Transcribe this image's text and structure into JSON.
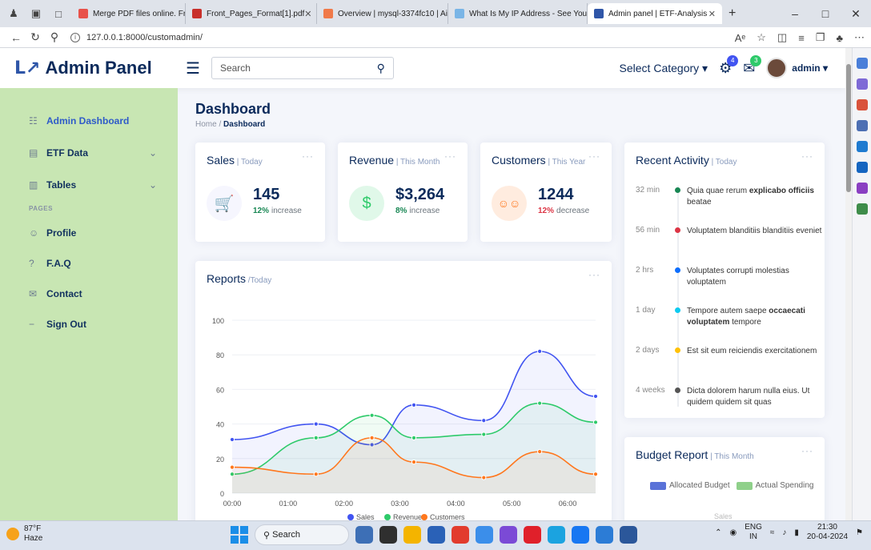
{
  "browser": {
    "tabs": [
      {
        "label": "Merge PDF files online. Free serv",
        "color": "#e8524a"
      },
      {
        "label": "Front_Pages_Format[1].pdf",
        "color": "#c8302b"
      },
      {
        "label": "Overview | mysql-3374fc10 | Aiv",
        "color": "#f07a4a"
      },
      {
        "label": "What Is My IP Address - See You",
        "color": "#7ab5e6"
      },
      {
        "label": "Admin panel | ETF-Analysis",
        "color": "#2f56a8"
      }
    ],
    "url": "127.0.0.1:8000/customadmin/"
  },
  "header": {
    "logo_mark": "L↗",
    "logo_text": "Admin Panel",
    "search_placeholder": "Search",
    "select_category": "Select Category ▾",
    "notif_count": "4",
    "msg_count": "3",
    "username": "admin ▾"
  },
  "sidebar": {
    "items": [
      {
        "label": "Admin Dashboard",
        "icon": "☷"
      },
      {
        "label": "ETF Data",
        "icon": "▤"
      },
      {
        "label": "Tables",
        "icon": "▥"
      },
      {
        "label": "Profile",
        "icon": "☺"
      },
      {
        "label": "F.A.Q",
        "icon": "?"
      },
      {
        "label": "Contact",
        "icon": "✉"
      },
      {
        "label": "Sign Out",
        "icon": "−"
      }
    ],
    "section_pages": "PAGES"
  },
  "dashboard": {
    "title": "Dashboard",
    "crumb_home": "Home",
    "crumb_sep": " / ",
    "crumb_current": "Dashboard"
  },
  "cards": {
    "sales": {
      "title": "Sales",
      "period": " | Today",
      "value": "145",
      "pct": "12%",
      "trend": "increase",
      "pct_color": "#198754",
      "icon": "☐"
    },
    "revenue": {
      "title": "Revenue",
      "period": " | This Month",
      "value": "$3,264",
      "pct": "8%",
      "trend": "increase",
      "pct_color": "#198754",
      "icon": "$"
    },
    "customers": {
      "title": "Customers",
      "period": " | This Year",
      "value": "1244",
      "pct": "12%",
      "trend": "decrease",
      "pct_color": "#dc3545",
      "icon": "☺☺"
    }
  },
  "reports": {
    "title": "Reports",
    "period": " /Today",
    "dots": "···"
  },
  "chart_data": {
    "type": "area",
    "x": [
      "00:00",
      "01:00",
      "02:00",
      "03:00",
      "04:00",
      "05:00",
      "06:00"
    ],
    "x_points": [
      0,
      1,
      2,
      2.5,
      3,
      3.5,
      4,
      5.5,
      6.5
    ],
    "ylim": [
      0,
      100
    ],
    "yticks": [
      "0",
      "20",
      "40",
      "60",
      "80",
      "100"
    ],
    "series": [
      {
        "name": "Sales",
        "color": "#4154f1",
        "points": [
          [
            0,
            31
          ],
          [
            1.5,
            40
          ],
          [
            2.5,
            28
          ],
          [
            3.25,
            51
          ],
          [
            4.5,
            42
          ],
          [
            5.5,
            82
          ],
          [
            6.5,
            56
          ]
        ]
      },
      {
        "name": "Revenue",
        "color": "#2eca6a",
        "points": [
          [
            0,
            11
          ],
          [
            1.5,
            32
          ],
          [
            2.5,
            45
          ],
          [
            3.25,
            32
          ],
          [
            4.5,
            34
          ],
          [
            5.5,
            52
          ],
          [
            6.5,
            41
          ]
        ]
      },
      {
        "name": "Customers",
        "color": "#ff771d",
        "points": [
          [
            0,
            15
          ],
          [
            1.5,
            11
          ],
          [
            2.5,
            32
          ],
          [
            3.25,
            18
          ],
          [
            4.5,
            9
          ],
          [
            5.5,
            24
          ],
          [
            6.5,
            11
          ]
        ]
      }
    ]
  },
  "activity": {
    "title": "Recent Activity",
    "period": " | Today",
    "items": [
      {
        "time": "32 min",
        "color": "#198754",
        "pre": "Quia quae rerum ",
        "bold": "explicabo officiis",
        "post": " beatae"
      },
      {
        "time": "56 min",
        "color": "#dc3545",
        "pre": "Voluptatem blanditiis blanditiis eveniet",
        "bold": "",
        "post": ""
      },
      {
        "time": "2 hrs",
        "color": "#0d6efd",
        "pre": "Voluptates corrupti molestias voluptatem",
        "bold": "",
        "post": ""
      },
      {
        "time": "1 day",
        "color": "#0dcaf0",
        "pre": "Tempore autem saepe ",
        "bold": "occaecati voluptatem",
        "post": " tempore"
      },
      {
        "time": "2 days",
        "color": "#ffc107",
        "pre": "Est sit eum reiciendis exercitationem",
        "bold": "",
        "post": ""
      },
      {
        "time": "4 weeks",
        "color": "#555555",
        "pre": "Dicta dolorem harum nulla eius. Ut quidem quidem sit quas",
        "bold": "",
        "post": ""
      }
    ]
  },
  "budget": {
    "title": "Budget Report",
    "period": " | This Month",
    "legend_allocated": "Allocated Budget",
    "legend_actual": "Actual Spending",
    "axis_label": "Sales"
  },
  "taskbar": {
    "weather_temp": "87°F",
    "weather_desc": "Haze",
    "search": "Search",
    "lang1": "ENG",
    "lang2": "IN",
    "time": "21:30",
    "date": "20-04-2024"
  }
}
